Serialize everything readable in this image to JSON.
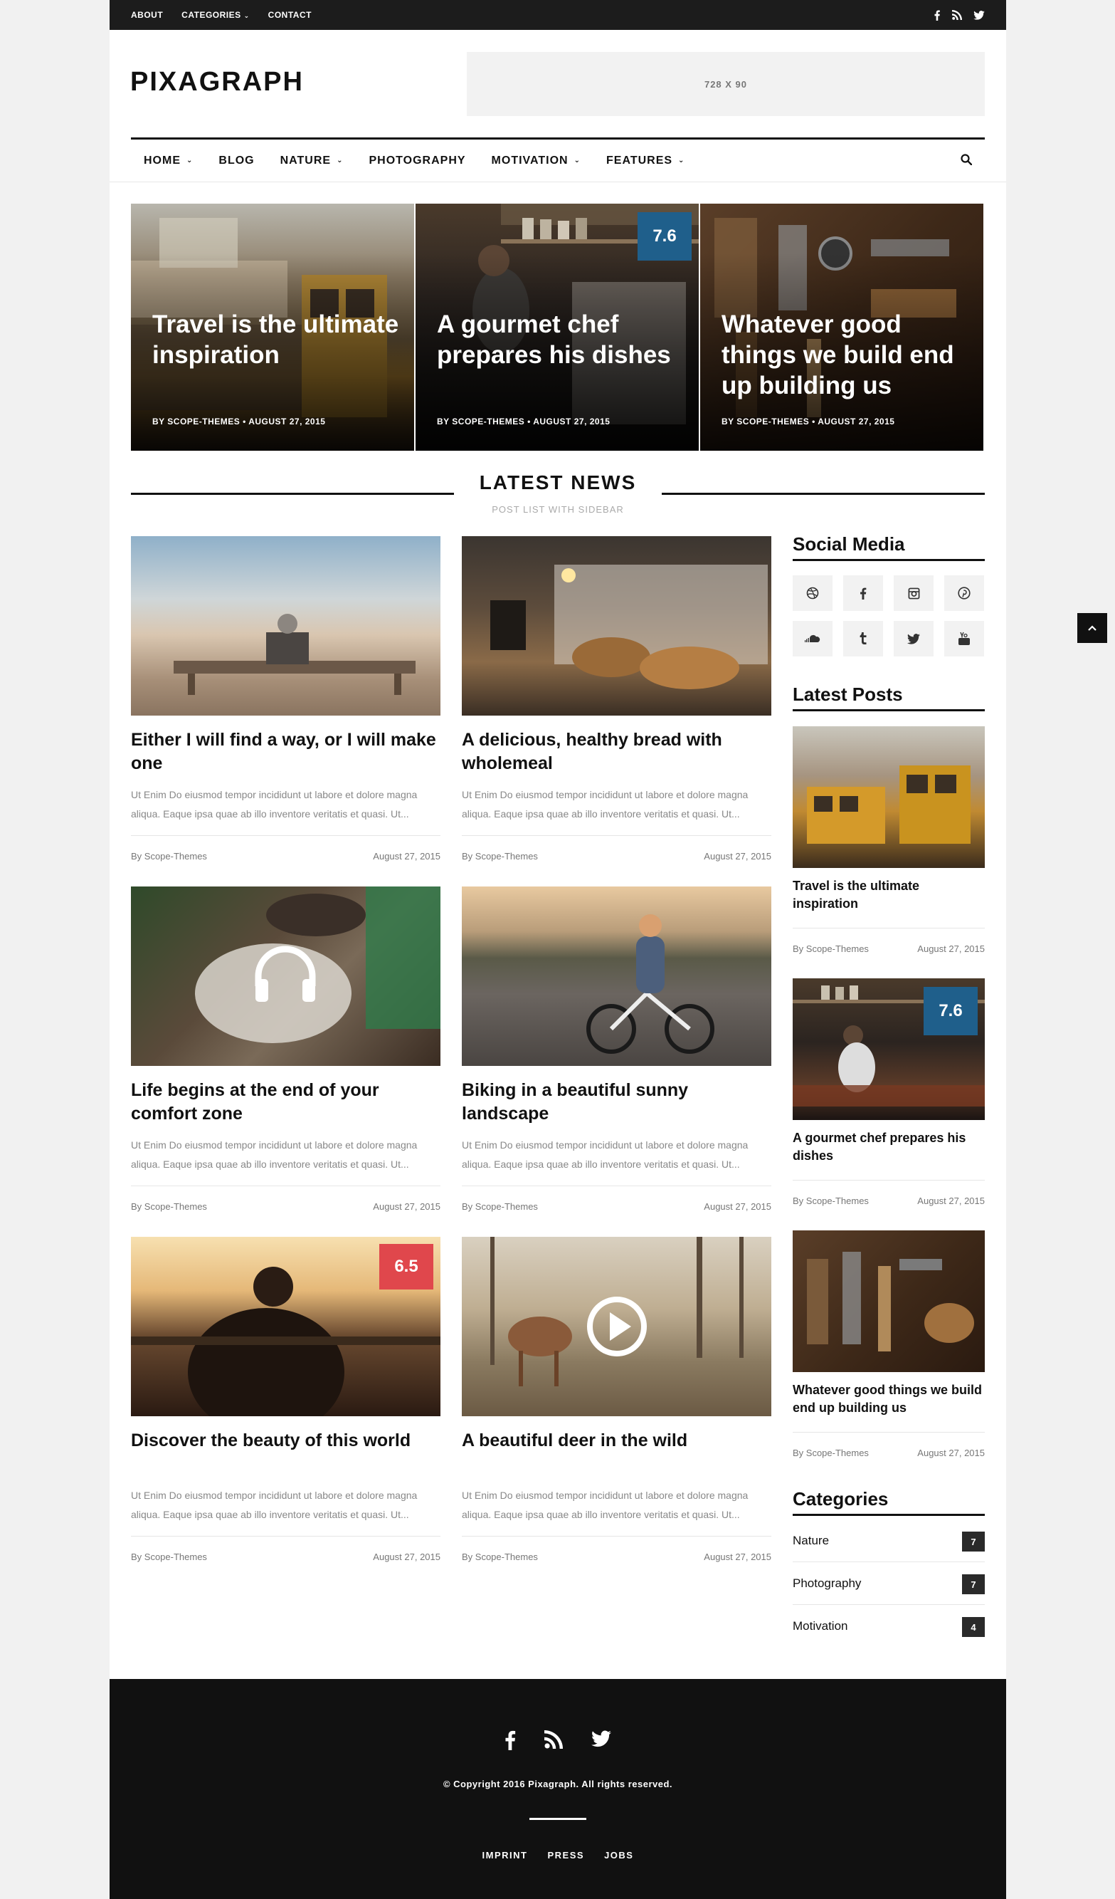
{
  "topbar": {
    "nav": [
      "ABOUT",
      "CATEGORIES",
      "CONTACT"
    ],
    "social_icons": [
      "facebook-icon",
      "rss-icon",
      "twitter-icon"
    ]
  },
  "header": {
    "logo": "PIXAGRAPH",
    "ad_label": "728 X 90"
  },
  "mainnav": {
    "items": [
      "HOME",
      "BLOG",
      "NATURE",
      "PHOTOGRAPHY",
      "MOTIVATION",
      "FEATURES"
    ]
  },
  "hero": [
    {
      "title": "Travel is the ultimate inspiration",
      "meta": "BY SCOPE-THEMES  •  AUGUST 27, 2015"
    },
    {
      "title": "A gourmet chef prepares his dishes",
      "meta": "BY SCOPE-THEMES  •  AUGUST 27, 2015",
      "score": "7.6"
    },
    {
      "title": "Whatever good things we build end up building us",
      "meta": "BY SCOPE-THEMES  •  AUGUST 27, 2015"
    }
  ],
  "section": {
    "title": "LATEST NEWS",
    "subtitle": "POST LIST WITH SIDEBAR"
  },
  "posts": [
    {
      "title": "Either I will find a way, or I will make one",
      "excerpt": "Ut Enim Do eiusmod tempor incididunt ut labore et dolore magna aliqua. Eaque ipsa quae ab illo inventore veritatis et quasi. Ut...",
      "author": "By Scope-Themes",
      "date": "August 27, 2015"
    },
    {
      "title": "A delicious, healthy bread with wholemeal",
      "excerpt": "Ut Enim Do eiusmod tempor incididunt ut labore et dolore magna aliqua. Eaque ipsa quae ab illo inventore veritatis et quasi. Ut...",
      "author": "By Scope-Themes",
      "date": "August 27, 2015"
    },
    {
      "title": "Life begins at the end of your comfort zone",
      "excerpt": "Ut Enim Do eiusmod tempor incididunt ut labore et dolore magna aliqua. Eaque ipsa quae ab illo inventore veritatis et quasi. Ut...",
      "author": "By Scope-Themes",
      "date": "August 27, 2015"
    },
    {
      "title": "Biking in a beautiful sunny landscape",
      "excerpt": "Ut Enim Do eiusmod tempor incididunt ut labore et dolore magna aliqua. Eaque ipsa quae ab illo inventore veritatis et quasi. Ut...",
      "author": "By Scope-Themes",
      "date": "August 27, 2015"
    },
    {
      "title": "Discover the beauty of this world",
      "excerpt": "Ut Enim Do eiusmod tempor incididunt ut labore et dolore magna aliqua. Eaque ipsa quae ab illo inventore veritatis et quasi. Ut...",
      "author": "By Scope-Themes",
      "date": "August 27, 2015",
      "score": "6.5"
    },
    {
      "title": "A beautiful deer in the wild",
      "excerpt": "Ut Enim Do eiusmod tempor incididunt ut labore et dolore magna aliqua. Eaque ipsa quae ab illo inventore veritatis et quasi. Ut...",
      "author": "By Scope-Themes",
      "date": "August 27, 2015"
    }
  ],
  "sidebar": {
    "social_title": "Social Media",
    "social_icons": [
      "dribbble-icon",
      "facebook-icon",
      "instagram-icon",
      "pinterest-icon",
      "soundcloud-icon",
      "tumblr-icon",
      "twitter-icon",
      "youtube-icon"
    ],
    "latest_title": "Latest Posts",
    "latest": [
      {
        "title": "Travel is the ultimate inspiration",
        "author": "By Scope-Themes",
        "date": "August 27, 2015"
      },
      {
        "title": "A gourmet chef prepares his dishes",
        "author": "By Scope-Themes",
        "date": "August 27, 2015",
        "score": "7.6"
      },
      {
        "title": "Whatever good things we build end up building us",
        "author": "By Scope-Themes",
        "date": "August 27, 2015"
      }
    ],
    "categories_title": "Categories",
    "categories": [
      {
        "name": "Nature",
        "count": "7"
      },
      {
        "name": "Photography",
        "count": "7"
      },
      {
        "name": "Motivation",
        "count": "4"
      }
    ]
  },
  "footer": {
    "social_icons": [
      "facebook-icon",
      "rss-icon",
      "twitter-icon"
    ],
    "copyright": "© Copyright 2016 Pixagraph. All rights reserved.",
    "links": [
      "IMPRINT",
      "PRESS",
      "JOBS"
    ]
  },
  "colors": {
    "score_blue": "#1f5f8b",
    "score_red": "#e0474c",
    "footer_bg": "#111111",
    "topbar_bg": "#1c1c1c"
  }
}
